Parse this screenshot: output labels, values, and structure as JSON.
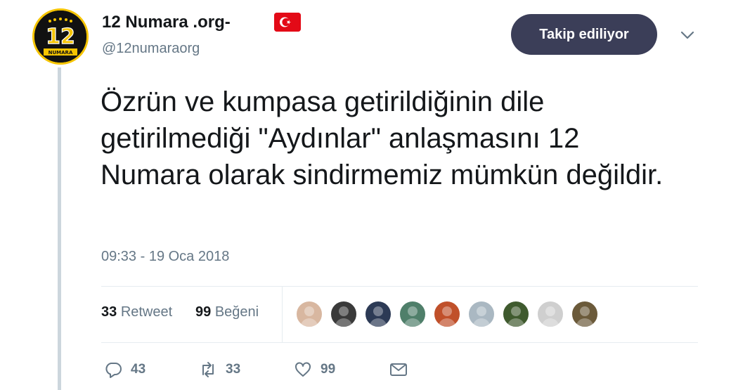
{
  "profile": {
    "avatar_text": "12",
    "avatar_subtext": "NUMARA",
    "display_name": "12 Numara .org-",
    "handle": "@12numaraorg",
    "flag_icon": "turkey-flag-icon"
  },
  "header": {
    "follow_label": "Takip ediliyor"
  },
  "tweet": {
    "text": "Özrün ve kumpasa getirildiğinin dile getirilmediği \"Aydınlar\" anlaşmasını 12 Numara olarak sindirmemiz mümkün değildir.",
    "timestamp": "09:33 - 19 Oca 2018"
  },
  "stats": {
    "retweet_count": "33",
    "retweet_label": "Retweet",
    "like_count": "99",
    "like_label": "Beğeni"
  },
  "likers": [
    {
      "color": "#d8b7a0"
    },
    {
      "color": "#3a3a3a"
    },
    {
      "color": "#2c3a55"
    },
    {
      "color": "#4f7f6a"
    },
    {
      "color": "#c0502a"
    },
    {
      "color": "#aab8c2"
    },
    {
      "color": "#3f5a2e"
    },
    {
      "color": "#cfcfcf"
    },
    {
      "color": "#6b5a3a"
    }
  ],
  "actions": {
    "reply_count": "43",
    "retweet_count": "33",
    "like_count": "99"
  },
  "colors": {
    "follow_bg": "#3b3e58",
    "muted": "#657786",
    "text": "#14171a",
    "thread_line": "#ccd6dd"
  }
}
